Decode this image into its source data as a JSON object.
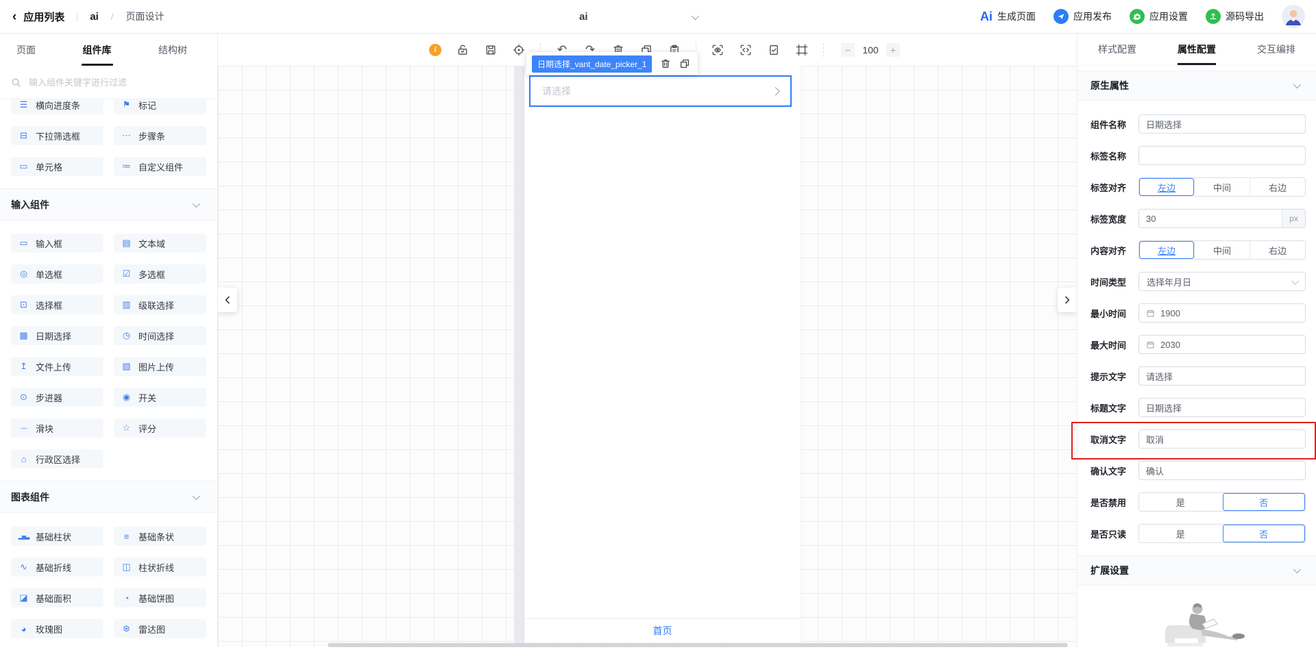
{
  "header": {
    "back_icon": "‹",
    "back_label": "应用列表",
    "app_name": "ai",
    "breadcrumb_sep": "/",
    "page_name": "页面设计",
    "page_select_value": "ai",
    "ai_logo": "Ai",
    "actions": [
      {
        "label": "生成页面",
        "icon": "ai-logo"
      },
      {
        "label": "应用发布",
        "icon": "publish-plane-icon"
      },
      {
        "label": "应用设置",
        "icon": "settings-gear-icon"
      },
      {
        "label": "源码导出",
        "icon": "export-code-icon"
      }
    ]
  },
  "sidebar": {
    "tabs": [
      {
        "label": "页面"
      },
      {
        "label": "组件库"
      },
      {
        "label": "结构树"
      }
    ],
    "active_tab": "组件库",
    "search_placeholder": "输入组件关键字进行过滤",
    "top_items": [
      {
        "label": "横向进度条",
        "icon": "progress-bar-icon",
        "glyph": "☰"
      },
      {
        "label": "标记",
        "icon": "marker-icon",
        "glyph": "⚑"
      },
      {
        "label": "下拉筛选框",
        "icon": "dropdown-filter-icon",
        "glyph": "⊟"
      },
      {
        "label": "步骤条",
        "icon": "steps-icon",
        "glyph": "⋯"
      },
      {
        "label": "单元格",
        "icon": "cell-icon",
        "glyph": "▭"
      },
      {
        "label": "自定义组件",
        "icon": "custom-component-icon",
        "glyph": "≔"
      }
    ],
    "sections": [
      {
        "title": "输入组件",
        "items": [
          {
            "label": "输入框",
            "icon": "input-box-icon",
            "glyph": "▭"
          },
          {
            "label": "文本域",
            "icon": "textarea-icon",
            "glyph": "▤"
          },
          {
            "label": "单选框",
            "icon": "radio-icon",
            "glyph": "◎"
          },
          {
            "label": "多选框",
            "icon": "checkbox-icon",
            "glyph": "☑"
          },
          {
            "label": "选择框",
            "icon": "select-box-icon",
            "glyph": "⊡"
          },
          {
            "label": "级联选择",
            "icon": "cascade-select-icon",
            "glyph": "▥"
          },
          {
            "label": "日期选择",
            "icon": "date-picker-icon",
            "glyph": "▦"
          },
          {
            "label": "时间选择",
            "icon": "time-picker-icon",
            "glyph": "◷"
          },
          {
            "label": "文件上传",
            "icon": "file-upload-icon",
            "glyph": "↥"
          },
          {
            "label": "图片上传",
            "icon": "image-upload-icon",
            "glyph": "▧"
          },
          {
            "label": "步进器",
            "icon": "stepper-icon",
            "glyph": "⊙"
          },
          {
            "label": "开关",
            "icon": "switch-icon",
            "glyph": "◉"
          },
          {
            "label": "滑块",
            "icon": "slider-icon",
            "glyph": "–◦–"
          },
          {
            "label": "评分",
            "icon": "rating-star-icon",
            "glyph": "☆"
          },
          {
            "label": "行政区选择",
            "icon": "district-select-icon",
            "glyph": "⌂"
          }
        ]
      },
      {
        "title": "图表组件",
        "items": [
          {
            "label": "基础柱状",
            "icon": "bar-chart-icon",
            "glyph": "▂▅▃"
          },
          {
            "label": "基础条状",
            "icon": "hbar-chart-icon",
            "glyph": "≡"
          },
          {
            "label": "基础折线",
            "icon": "line-chart-icon",
            "glyph": "∿"
          },
          {
            "label": "柱状折线",
            "icon": "combo-chart-icon",
            "glyph": "◫"
          },
          {
            "label": "基础面积",
            "icon": "area-chart-icon",
            "glyph": "◪"
          },
          {
            "label": "基础饼图",
            "icon": "pie-chart-icon",
            "glyph": "◔"
          },
          {
            "label": "玫瑰图",
            "icon": "rose-chart-icon",
            "glyph": "◕"
          },
          {
            "label": "雷达图",
            "icon": "radar-chart-icon",
            "glyph": "⊛"
          }
        ]
      }
    ]
  },
  "toolbar": {
    "info_glyph": "i",
    "undo_glyph": "↶",
    "redo_glyph": "↷",
    "zoom": {
      "minus": "−",
      "value": "100",
      "plus": "+"
    }
  },
  "canvas": {
    "selected_tag": "日期选择_vant_date_picker_1",
    "picker_placeholder": "请选择",
    "tabbar_home": "首页"
  },
  "inspector": {
    "tabs": [
      {
        "label": "样式配置"
      },
      {
        "label": "属性配置"
      },
      {
        "label": "交互编排"
      }
    ],
    "active_tab": "属性配置",
    "section_native": "原生属性",
    "section_extend": "扩展设置",
    "accent_color": "#3d84fb",
    "highlight_color": "#df1f1f",
    "fields": [
      {
        "label": "组件名称",
        "type": "input",
        "value": "日期选择"
      },
      {
        "label": "标签名称",
        "type": "input",
        "value": ""
      },
      {
        "label": "标签对齐",
        "type": "segmented",
        "options": [
          "左边",
          "中间",
          "右边"
        ],
        "selected": "左边"
      },
      {
        "label": "标签宽度",
        "type": "input-suffix",
        "value": "30",
        "suffix": "px"
      },
      {
        "label": "内容对齐",
        "type": "segmented",
        "options": [
          "左边",
          "中间",
          "右边"
        ],
        "selected": "左边"
      },
      {
        "label": "时间类型",
        "type": "select",
        "value": "选择年月日"
      },
      {
        "label": "最小时间",
        "type": "date-input",
        "value": "1900"
      },
      {
        "label": "最大时间",
        "type": "date-input",
        "value": "2030"
      },
      {
        "label": "提示文字",
        "type": "input",
        "value": "请选择"
      },
      {
        "label": "标题文字",
        "type": "input",
        "value": "日期选择"
      },
      {
        "label": "取消文字",
        "type": "input",
        "value": "取消",
        "highlighted": true
      },
      {
        "label": "确认文字",
        "type": "input",
        "value": "确认"
      },
      {
        "label": "是否禁用",
        "type": "segmented",
        "options": [
          "是",
          "否"
        ],
        "selected": "否"
      },
      {
        "label": "是否只读",
        "type": "segmented",
        "options": [
          "是",
          "否"
        ],
        "selected": "否"
      }
    ]
  }
}
